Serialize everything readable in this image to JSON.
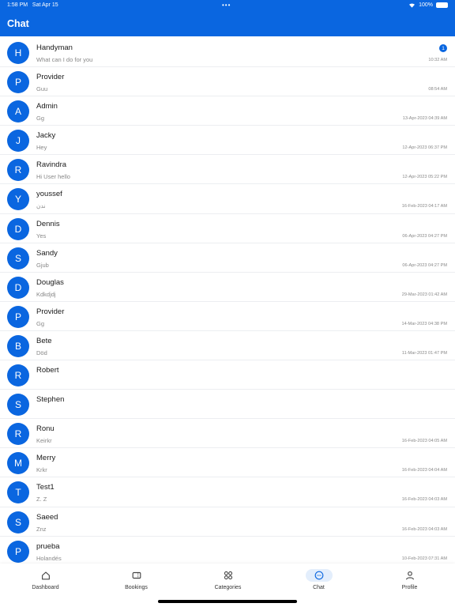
{
  "status": {
    "time": "1:58 PM",
    "date": "Sat Apr 15",
    "battery": "100%",
    "dots": "•••"
  },
  "header": {
    "title": "Chat"
  },
  "chats": [
    {
      "initial": "H",
      "name": "Handyman",
      "message": "What can I do for you",
      "time": "10:32 AM",
      "badge": "1"
    },
    {
      "initial": "P",
      "name": "Provider",
      "message": "Guu",
      "time": "08:54 AM"
    },
    {
      "initial": "A",
      "name": "Admin",
      "message": "Gg",
      "time": "13-Apr-2023 04:39 AM"
    },
    {
      "initial": "J",
      "name": "Jacky",
      "message": "Hey",
      "time": "12-Apr-2023 06:37 PM"
    },
    {
      "initial": "R",
      "name": "Ravindra",
      "message": "Hi User hello",
      "time": "12-Apr-2023 05:22 PM"
    },
    {
      "initial": "Y",
      "name": "youssef",
      "message": "ندن",
      "time": "16-Feb-2023 04:17 AM"
    },
    {
      "initial": "D",
      "name": "Dennis",
      "message": "Yes",
      "time": "06-Apr-2023 04:27 PM"
    },
    {
      "initial": "S",
      "name": "Sandy",
      "message": "Gjub",
      "time": "06-Apr-2023 04:27 PM"
    },
    {
      "initial": "D",
      "name": "Douglas",
      "message": "Kdkdjdj",
      "time": "29-Mar-2023 01:42 AM"
    },
    {
      "initial": "P",
      "name": "Provider",
      "message": "Gg",
      "time": "14-Mar-2023 04:38 PM"
    },
    {
      "initial": "B",
      "name": "Bete",
      "message": "Död",
      "time": "11-Mar-2023 01:47 PM"
    },
    {
      "initial": "R",
      "name": "Robert",
      "message": "",
      "time": ""
    },
    {
      "initial": "S",
      "name": "Stephen",
      "message": "",
      "time": ""
    },
    {
      "initial": "R",
      "name": "Ronu",
      "message": "Keirkr",
      "time": "16-Feb-2023 04:05 AM"
    },
    {
      "initial": "M",
      "name": "Merry",
      "message": "Krkr",
      "time": "16-Feb-2023 04:04 AM"
    },
    {
      "initial": "T",
      "name": "Test1",
      "message": " Z. Z",
      "time": "16-Feb-2023 04:03 AM"
    },
    {
      "initial": "S",
      "name": "Saeed",
      "message": " Znz",
      "time": "16-Feb-2023 04:03 AM"
    },
    {
      "initial": "P",
      "name": "prueba",
      "message": "Holandés",
      "time": "10-Feb-2023 07:31 AM"
    }
  ],
  "nav": [
    {
      "label": "Dashboard",
      "icon": "home-icon"
    },
    {
      "label": "Bookings",
      "icon": "ticket-icon"
    },
    {
      "label": "Categories",
      "icon": "grid-icon"
    },
    {
      "label": "Chat",
      "icon": "chat-icon",
      "active": true
    },
    {
      "label": "Profile",
      "icon": "user-icon"
    }
  ],
  "colors": {
    "primary": "#0a66e0",
    "active_bg": "#e3eefc"
  }
}
